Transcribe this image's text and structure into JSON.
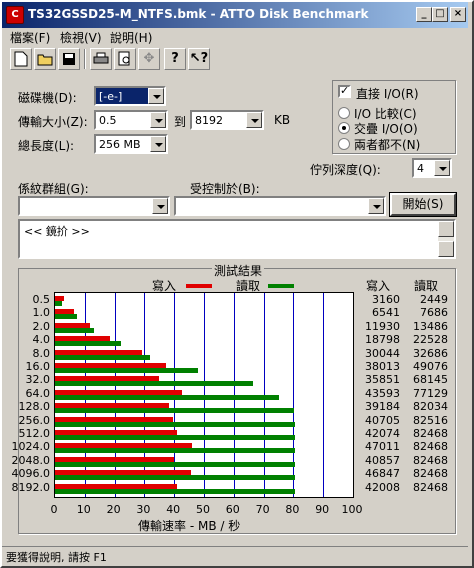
{
  "window": {
    "title": "TS32GSSD25-M_NTFS.bmk - ATTO Disk Benchmark",
    "icon_text": "C"
  },
  "menu": [
    "檔案(F)",
    "檢視(V)",
    "說明(H)"
  ],
  "toolbar": [
    "new-icon",
    "open-icon",
    "save-icon",
    "print-icon",
    "print-preview-icon",
    "move-icon",
    "help-icon",
    "context-help-icon"
  ],
  "settings": {
    "drive_label": "磁碟機(D):",
    "drive_value": "[-e-]",
    "transfer_label": "傳輸大小(Z):",
    "transfer_from": "0.5",
    "to_label": "到",
    "transfer_to": "8192",
    "unit": "KB",
    "length_label": "總長度(L):",
    "length_value": "256 MB",
    "direct_io_label": "直接 I/O(R)",
    "direct_io_checked": true,
    "radio_compare": "I/O 比較(C)",
    "radio_overlap": "交疊 I/O(O)",
    "radio_neither": "兩者都不(N)",
    "queue_label": "佇列深度(Q):",
    "queue_value": "4",
    "group_label": "係紋群組(G):",
    "group_value": "",
    "controlled_label": "受控制於(B):",
    "controlled_value": "",
    "start_button": "開始(S)"
  },
  "description": "<< 鏡扴 >>",
  "results": {
    "title": "測試結果",
    "legend_write": "寫入",
    "legend_read": "讀取",
    "col_write": "寫入",
    "col_read": "讀取",
    "xlabel": "傳輸速率 - MB / 秒",
    "x_ticks": [
      "0",
      "10",
      "20",
      "30",
      "40",
      "50",
      "60",
      "70",
      "80",
      "90",
      "100"
    ]
  },
  "chart_data": {
    "type": "bar",
    "orientation": "horizontal",
    "title": "測試結果",
    "xlabel": "傳輸速率 - MB / 秒",
    "xlim": [
      0,
      100
    ],
    "categories": [
      "0.5",
      "1.0",
      "2.0",
      "4.0",
      "8.0",
      "16.0",
      "32.0",
      "64.0",
      "128.0",
      "256.0",
      "512.0",
      "1024.0",
      "2048.0",
      "4096.0",
      "8192.0"
    ],
    "series": [
      {
        "name": "寫入",
        "color": "#e00000",
        "values": [
          3.1,
          6.4,
          11.7,
          18.4,
          29.3,
          37.1,
          35.0,
          42.6,
          38.3,
          39.7,
          41.1,
          45.9,
          39.9,
          45.7,
          41.0
        ],
        "printed": [
          3160,
          6541,
          11930,
          18798,
          30044,
          38013,
          35851,
          43593,
          39184,
          40705,
          42074,
          47011,
          40857,
          46847,
          42008
        ]
      },
      {
        "name": "讀取",
        "color": "#008000",
        "values": [
          2.4,
          7.5,
          13.2,
          22.0,
          31.9,
          47.9,
          66.5,
          75.3,
          80.1,
          80.6,
          80.5,
          80.5,
          80.5,
          80.5,
          80.5
        ],
        "printed": [
          2449,
          7686,
          13486,
          22528,
          32686,
          49076,
          68145,
          77129,
          82034,
          82516,
          82468,
          82468,
          82468,
          82468,
          82468
        ]
      }
    ]
  },
  "status": "要獲得說明, 請按 F1"
}
